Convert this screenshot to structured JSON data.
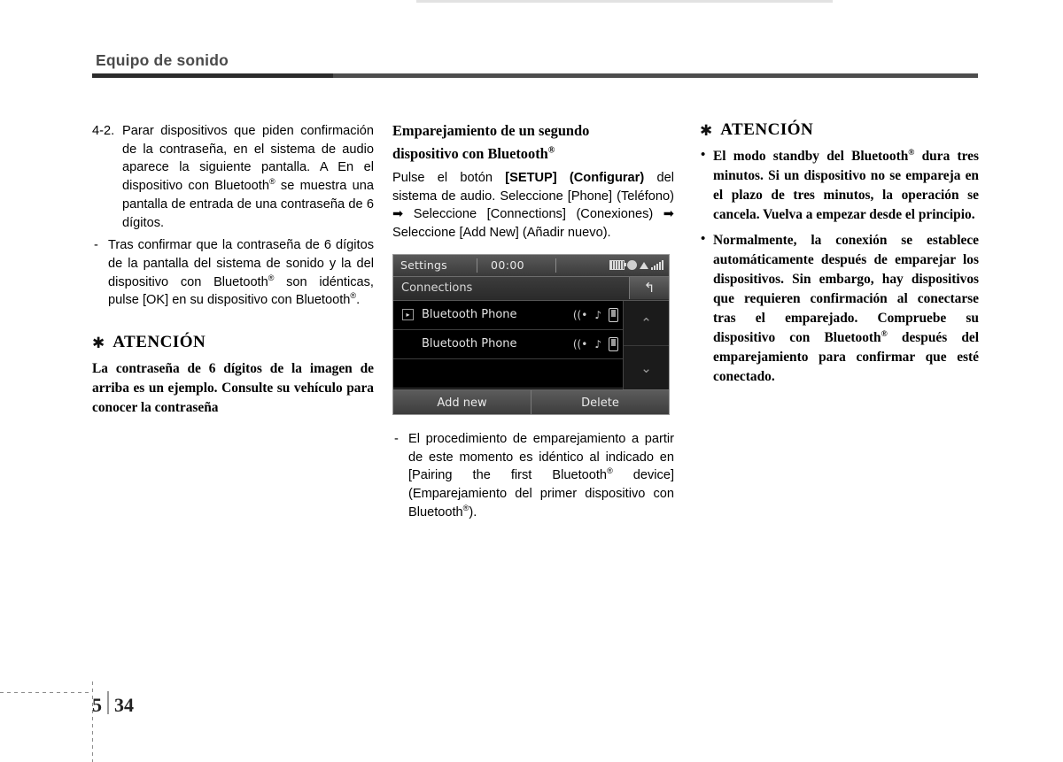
{
  "header": {
    "title": "Equipo de sonido"
  },
  "col1": {
    "item1": {
      "marker": "4-2.",
      "text": "Parar dispositivos que piden confirmación de la contraseña, en el sistema de audio aparece la siguiente pantalla. A En el dispositivo con Bluetooth® se muestra una pantalla de entrada de una contraseña de 6 dígitos."
    },
    "item2": {
      "marker": "-",
      "text": "Tras confirmar que la contraseña de 6 dígitos de la pantalla del sistema de sonido y la del dispositivo con Bluetooth® son idénticas, pulse [OK] en su dispositivo con Bluetooth®."
    },
    "caution": {
      "star": "✱",
      "title": "ATENCIÓN",
      "body": "La contraseña de 6 dígitos de la imagen de arriba es un ejemplo. Consulte su vehículo para conocer la contraseña"
    }
  },
  "col2": {
    "heading_line1": "Emparejamiento de un segundo",
    "heading_line2": "dispositivo con Bluetooth®",
    "intro_before": "Pulse el botón ",
    "intro_bold": "[SETUP] (Configurar)",
    "intro_after": " del sistema de audio. Seleccione [Phone] (Teléfono) ➡ Seleccione [Connections] (Conexiones) ➡ Seleccione [Add New] (Añadir nuevo).",
    "device": {
      "status_title": "Settings",
      "clock": "00:00",
      "icons": [
        "battery-icon",
        "mute-icon",
        "arrow-icon",
        "signal-icon"
      ],
      "screen_title": "Connections",
      "back_icon": "↰",
      "list": [
        {
          "name": "Bluetooth Phone",
          "selected": true,
          "icons": [
            "bt-signal-icon",
            "music-note-icon",
            "phone-icon"
          ]
        },
        {
          "name": "Bluetooth Phone",
          "selected": false,
          "icons": [
            "bt-signal-icon",
            "music-note-icon",
            "phone-icon"
          ]
        }
      ],
      "scroll_up": "⌃",
      "scroll_down": "⌄",
      "footer_buttons": [
        "Add new",
        "Delete"
      ]
    },
    "after_item": {
      "marker": "-",
      "text": "El procedimiento de emparejamiento a partir de este momento es idéntico al indicado en [Pairing the first Bluetooth® device] (Emparejamiento del primer dispositivo con Bluetooth®)."
    }
  },
  "col3": {
    "caution": {
      "star": "✱",
      "title": "ATENCIÓN",
      "bullets": [
        "El modo standby del Bluetooth® dura tres minutos. Si un dispositivo no se empareja en el plazo de tres minutos, la operación se cancela. Vuelva a empezar desde el principio.",
        "Normalmente, la conexión se establece automáticamente después de emparejar los dispositivos. Sin embargo, hay dispositivos que requieren confirmación al conectarse tras el emparejado. Compruebe su dispositivo con Bluetooth® después del emparejamiento para confirmar que esté conectado."
      ]
    }
  },
  "footer": {
    "chapter": "5",
    "page": "34"
  }
}
